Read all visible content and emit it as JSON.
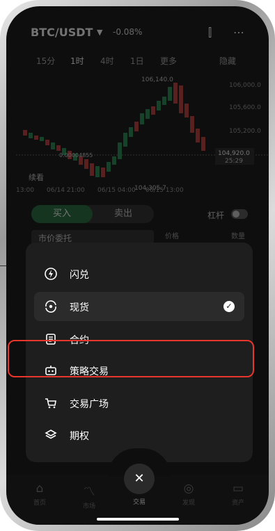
{
  "header": {
    "pair": "BTC/USDT",
    "change": "-0.08%",
    "icons": [
      "chevron-down-icon",
      "candlestick-icon",
      "more-icon"
    ]
  },
  "timeframes": [
    "15分",
    "1时",
    "4时",
    "1日",
    "更多",
    "隐藏"
  ],
  "active_timeframe": "1时",
  "chart": {
    "price_labels": [
      "106,140.0",
      "106,000.0",
      "105,600.0",
      "105,200.0",
      "104,920.0",
      "104,305.7"
    ],
    "countdown": "25:29",
    "avg_label": "0.00004855",
    "time_labels": [
      "13:00",
      "06/14 21:00",
      "06/15 04:00",
      "06/15 13:00"
    ],
    "crosshair_label": "续看",
    "colors": {
      "up": "#1f8a4c",
      "down": "#c0393b"
    }
  },
  "trade": {
    "buy": "买入",
    "sell": "卖出",
    "leverage": "杠杆",
    "order_type": "市价委托",
    "col_price": "价格",
    "col_amount": "数量"
  },
  "menu": {
    "items": [
      {
        "label": "闪兑",
        "icon": "flash-swap-icon",
        "selected": false
      },
      {
        "label": "现货",
        "icon": "spot-icon",
        "selected": true
      },
      {
        "label": "合约",
        "icon": "contract-icon",
        "selected": false
      },
      {
        "label": "策略交易",
        "icon": "bot-icon",
        "selected": false
      },
      {
        "label": "交易广场",
        "icon": "cart-icon",
        "selected": false
      },
      {
        "label": "期权",
        "icon": "layers-icon",
        "selected": false
      }
    ],
    "highlight_color": "#e8362b"
  },
  "bottom_nav": [
    {
      "label": "首页",
      "icon": "home-icon"
    },
    {
      "label": "市场",
      "icon": "chart-icon"
    },
    {
      "label": "交易",
      "icon": "close-icon"
    },
    {
      "label": "发现",
      "icon": "compass-icon"
    },
    {
      "label": "资产",
      "icon": "wallet-icon"
    }
  ]
}
